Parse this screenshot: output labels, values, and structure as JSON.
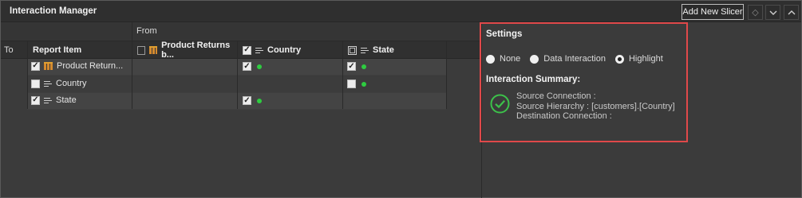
{
  "window": {
    "title": "Interaction Manager"
  },
  "toolbar": {
    "add_label": "Add New Slicer",
    "icons": [
      "diamond-icon",
      "chevron-down-icon",
      "chevron-up-icon"
    ]
  },
  "grid": {
    "from_label": "From",
    "to_label": "To",
    "columns": [
      {
        "label": "Report Item"
      },
      {
        "label": "Product Returns b...",
        "checkbox": "dark",
        "icon": "table-icon"
      },
      {
        "label": "Country",
        "checkbox": "checked",
        "icon": "list-icon"
      },
      {
        "label": "State",
        "checkbox": "hollow",
        "icon": "list-icon"
      }
    ],
    "rows": [
      {
        "name": "Product Return...",
        "checked": true,
        "icon": "table-icon",
        "country": {
          "checked": true,
          "dot": true
        },
        "state": {
          "checked": true,
          "dot": true
        }
      },
      {
        "name": "Country",
        "checked": false,
        "icon": "list-icon",
        "country": {
          "checked": null,
          "dot": false
        },
        "state": {
          "checked": false,
          "dot": true
        }
      },
      {
        "name": "State",
        "checked": true,
        "icon": "list-icon",
        "country": {
          "checked": true,
          "dot": true
        },
        "state": {
          "checked": null,
          "dot": false
        }
      }
    ]
  },
  "settings": {
    "title": "Settings",
    "options": [
      {
        "label": "None",
        "selected": false
      },
      {
        "label": "Data Interaction",
        "selected": false
      },
      {
        "label": "Highlight",
        "selected": true
      }
    ],
    "summary_title": "Interaction Summary:",
    "summary_lines": [
      "Source Connection :",
      "Source Hierarchy : [customers].[Country]",
      "Destination Connection :"
    ]
  },
  "colors": {
    "accent_border": "#e0494a",
    "status_dot": "#2ecc40",
    "check": "#3cc24a"
  }
}
